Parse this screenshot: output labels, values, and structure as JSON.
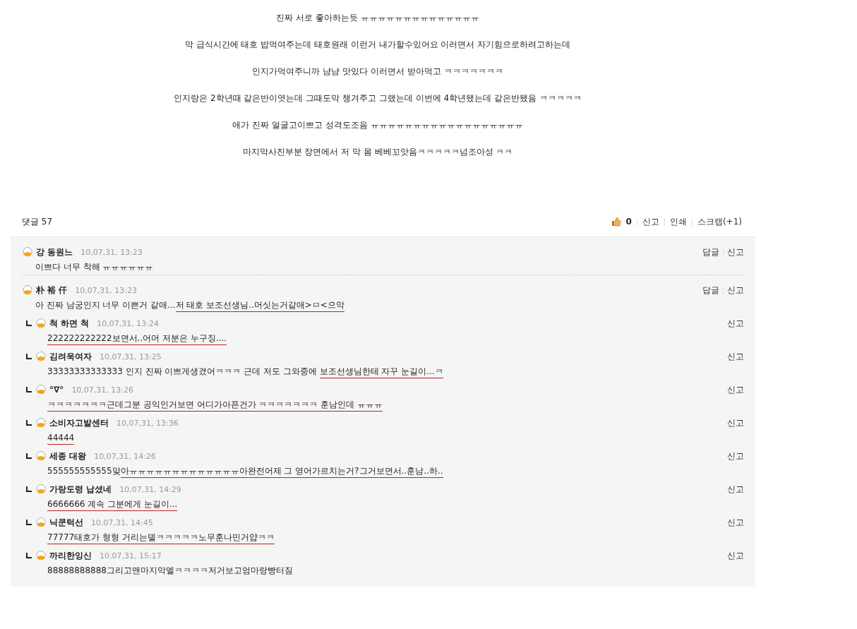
{
  "article": {
    "lines": [
      "진짜 서로 좋아하는듯 ㅠㅠㅠㅠㅠㅠㅠㅠㅠㅠㅠㅠㅠㅠ",
      "막 급식시간에 태호 밥먹여주는데 태호원래 이런거 내가할수있어요 이러면서 자기힘으로하려고하는데",
      "인지가먹여주니까 냠냠 맛있다 이러면서 받아먹고 ㅋㅋㅋㅋㅋㅋㅋ",
      "인지랑은 2학년때 같은반이엿는데 그때도막 챙겨주고 그랬는데 이번에 4학년됐는데 같은반됐음 ㅋㅋㅋㅋㅋ",
      "애가 진짜 얼굴고이쁘고 성격도조음 ㅠㅠㅠㅠㅠㅠㅠㅠㅠㅠㅠㅠㅠㅠㅠㅠㅠㅠ",
      "마지막사진부분 장면에서 저 막 몸 베베꼬앗음ㅋㅋㅋㅋㅋ넘조아성 ㅋㅋ"
    ]
  },
  "comments_header": {
    "title": "댓글 57",
    "likes": "0",
    "actions": [
      "신고",
      "인쇄",
      "스크랩(+1)"
    ]
  },
  "comments": [
    {
      "author": "강 동원느",
      "time": "10,07,31, 13:23",
      "segments": [
        {
          "text": "이쁘다 너무 착해 ㅠㅠㅠㅠㅠㅠ",
          "underlined": false
        }
      ],
      "actions": [
        "답글",
        "신고"
      ]
    },
    {
      "author": "朴 裕 仟",
      "time": "10,07,31, 13:23",
      "segments": [
        {
          "text": "아 진짜 남궁인지 너무 이쁜거 같애...",
          "underlined": false
        },
        {
          "text": "저 태호 보조선생님..머싯는거같애>ㅁ<으악",
          "underlined": true
        }
      ],
      "actions": [
        "답글",
        "신고"
      ],
      "children": [
        {
          "author": "척 하면 척",
          "time": "10,07,31, 13:24",
          "segments": [
            {
              "text": "222222222222보면서..어머 저분은 누구징....",
              "underlined": true
            }
          ],
          "actions": [
            "신고"
          ]
        },
        {
          "author": "김려욱여자",
          "time": "10,07,31, 13:25",
          "segments": [
            {
              "text": "33333333333333 인지 진짜 이쁘게생겼어ㅋㅋㅋ 근데 저도 그와중에 ",
              "underlined": false
            },
            {
              "text": "보조선생님한테 자꾸 눈길이...ㅋ",
              "underlined": true
            }
          ],
          "actions": [
            "신고"
          ]
        },
        {
          "author": "°∇°",
          "time": "10,07,31, 13:26",
          "segments": [
            {
              "text": "ㅋㅋㅋㅋㅋㅋㅋ근데그분 공익인거보면 어디가아픈건가 ㅋㅋㅋㅋㅋㅋㅋ 훈남인데 ㅠㅠㅠ",
              "underlined": true
            }
          ],
          "actions": [
            "신고"
          ]
        },
        {
          "author": "소비자고발센터",
          "time": "10,07,31, 13:36",
          "segments": [
            {
              "text": "44444",
              "underlined": true
            }
          ],
          "actions": [
            "신고"
          ]
        },
        {
          "author": "세종 대왕",
          "time": "10,07,31, 14:26",
          "segments": [
            {
              "text": "555555555555맞",
              "underlined": false
            },
            {
              "text": "아ㅠㅠㅠㅠㅠㅠㅠㅠㅠㅠㅠㅠㅠ아완전어제 그 영어가르치는거?그거보면서..훈남..하..",
              "underlined": true
            }
          ],
          "actions": [
            "신고"
          ]
        },
        {
          "author": "가랑도령 납셨네",
          "time": "10,07,31, 14:29",
          "segments": [
            {
              "text": "6666666 계속 그분에게 눈길이...",
              "underlined": true
            }
          ],
          "actions": [
            "신고"
          ]
        },
        {
          "author": "닉쿤턱선",
          "time": "10,07,31, 14:45",
          "segments": [
            {
              "text": "77777태호가 형형 거리는델ㅋㅋㅋㅋㅋ노무훈나민거얍ㅋㅋ",
              "underlined": true
            }
          ],
          "actions": [
            "신고"
          ]
        },
        {
          "author": "까리한잉신",
          "time": "10,07,31, 15:17",
          "segments": [
            {
              "text": "88888888888그리고맨마지막엘ㅋㅋㅋㅋ저거보고엄마랑빵터짐",
              "underlined": false
            }
          ],
          "actions": [
            "신고"
          ]
        }
      ]
    }
  ]
}
